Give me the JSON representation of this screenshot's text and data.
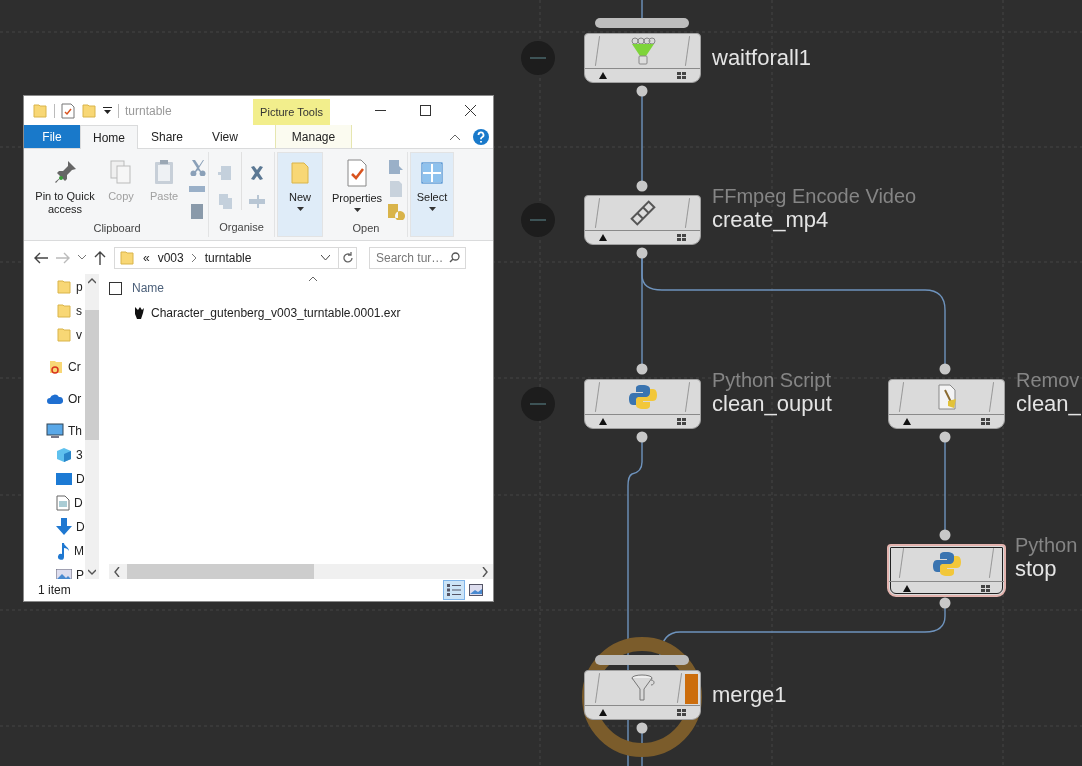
{
  "explorer": {
    "title": "turntable",
    "context_tab": "Picture Tools",
    "tabs": [
      {
        "label": "File",
        "kind": "file",
        "selected": false
      },
      {
        "label": "Home",
        "kind": "normal",
        "selected": true
      },
      {
        "label": "Share",
        "kind": "normal",
        "selected": false
      },
      {
        "label": "View",
        "kind": "normal",
        "selected": false
      },
      {
        "label": "Manage",
        "kind": "context",
        "selected": false
      }
    ],
    "ribbon_groups": [
      {
        "label": "Clipboard",
        "buttons": [
          {
            "kind": "pin",
            "label": "Pin to Quick access",
            "disabled": false
          },
          {
            "kind": "copy",
            "label": "Copy",
            "disabled": true
          },
          {
            "kind": "paste",
            "label": "Paste",
            "disabled": true
          },
          {
            "kind": "clip_stack"
          }
        ]
      },
      {
        "label": "Organise",
        "buttons": [
          {
            "kind": "move_stack"
          },
          {
            "kind": "delete_stack"
          }
        ]
      },
      {
        "highlighted": true,
        "buttons": [
          {
            "kind": "new",
            "label": "New",
            "disabled": false,
            "dropdown": true
          }
        ]
      },
      {
        "label": "Open",
        "buttons": [
          {
            "kind": "properties",
            "label": "Properties",
            "disabled": false,
            "dropdown": true
          },
          {
            "kind": "open_stack"
          }
        ]
      },
      {
        "highlighted": true,
        "buttons": [
          {
            "kind": "select",
            "label": "Select",
            "disabled": false,
            "dropdown": true
          }
        ]
      }
    ],
    "address": {
      "overflow": "«",
      "crumbs": [
        "v003",
        "turntable"
      ]
    },
    "search": {
      "placeholder": "Search tur…"
    },
    "nav_items": [
      {
        "label": "p",
        "kind": "folder"
      },
      {
        "label": "s",
        "kind": "folder"
      },
      {
        "label": "v",
        "kind": "folder"
      },
      {
        "label": "Cr",
        "kind": "cloud_folder"
      },
      {
        "label": "Or",
        "kind": "onedrive"
      },
      {
        "label": "Th",
        "kind": "pc"
      },
      {
        "label": "3",
        "kind": "objects"
      },
      {
        "label": "D",
        "kind": "desktop"
      },
      {
        "label": "D",
        "kind": "documents"
      },
      {
        "label": "D",
        "kind": "downloads"
      },
      {
        "label": "M",
        "kind": "music"
      },
      {
        "label": "P",
        "kind": "pictures"
      }
    ],
    "columns": [
      {
        "label": "Name",
        "checked": false
      }
    ],
    "files": [
      {
        "name": "Character_gutenberg_v003_turntable.0001.exr"
      }
    ],
    "status": "1 item",
    "view_buttons": [
      {
        "kind": "details",
        "selected": true
      },
      {
        "kind": "large",
        "selected": false
      }
    ]
  },
  "nodes": [
    {
      "name": "waitforall1",
      "kind": "wait",
      "bypass_badge": true,
      "input_bar": true,
      "highlighted": false,
      "display_flag": false,
      "ring": false
    },
    {
      "type_label": "FFmpeg Encode Video",
      "name": "create_mp4",
      "kind": "film",
      "bypass_badge": true,
      "input_bar": false,
      "highlighted": false,
      "display_flag": false,
      "ring": false
    },
    {
      "type_label": "Python Script",
      "name": "clean_ouput",
      "kind": "python",
      "bypass_badge": true,
      "input_bar": false,
      "highlighted": false,
      "display_flag": false,
      "ring": false
    },
    {
      "type_label": "Remov",
      "name": "clean_",
      "kind": "cleanup",
      "bypass_badge": false,
      "input_bar": false,
      "highlighted": false,
      "display_flag": false,
      "ring": false
    },
    {
      "type_label": "Python",
      "name": "stop",
      "kind": "python",
      "bypass_badge": false,
      "input_bar": false,
      "highlighted": true,
      "display_flag": false,
      "ring": false
    },
    {
      "name": "merge1",
      "kind": "funnel",
      "bypass_badge": false,
      "input_bar": true,
      "highlighted": false,
      "display_flag": true,
      "ring": true
    }
  ]
}
